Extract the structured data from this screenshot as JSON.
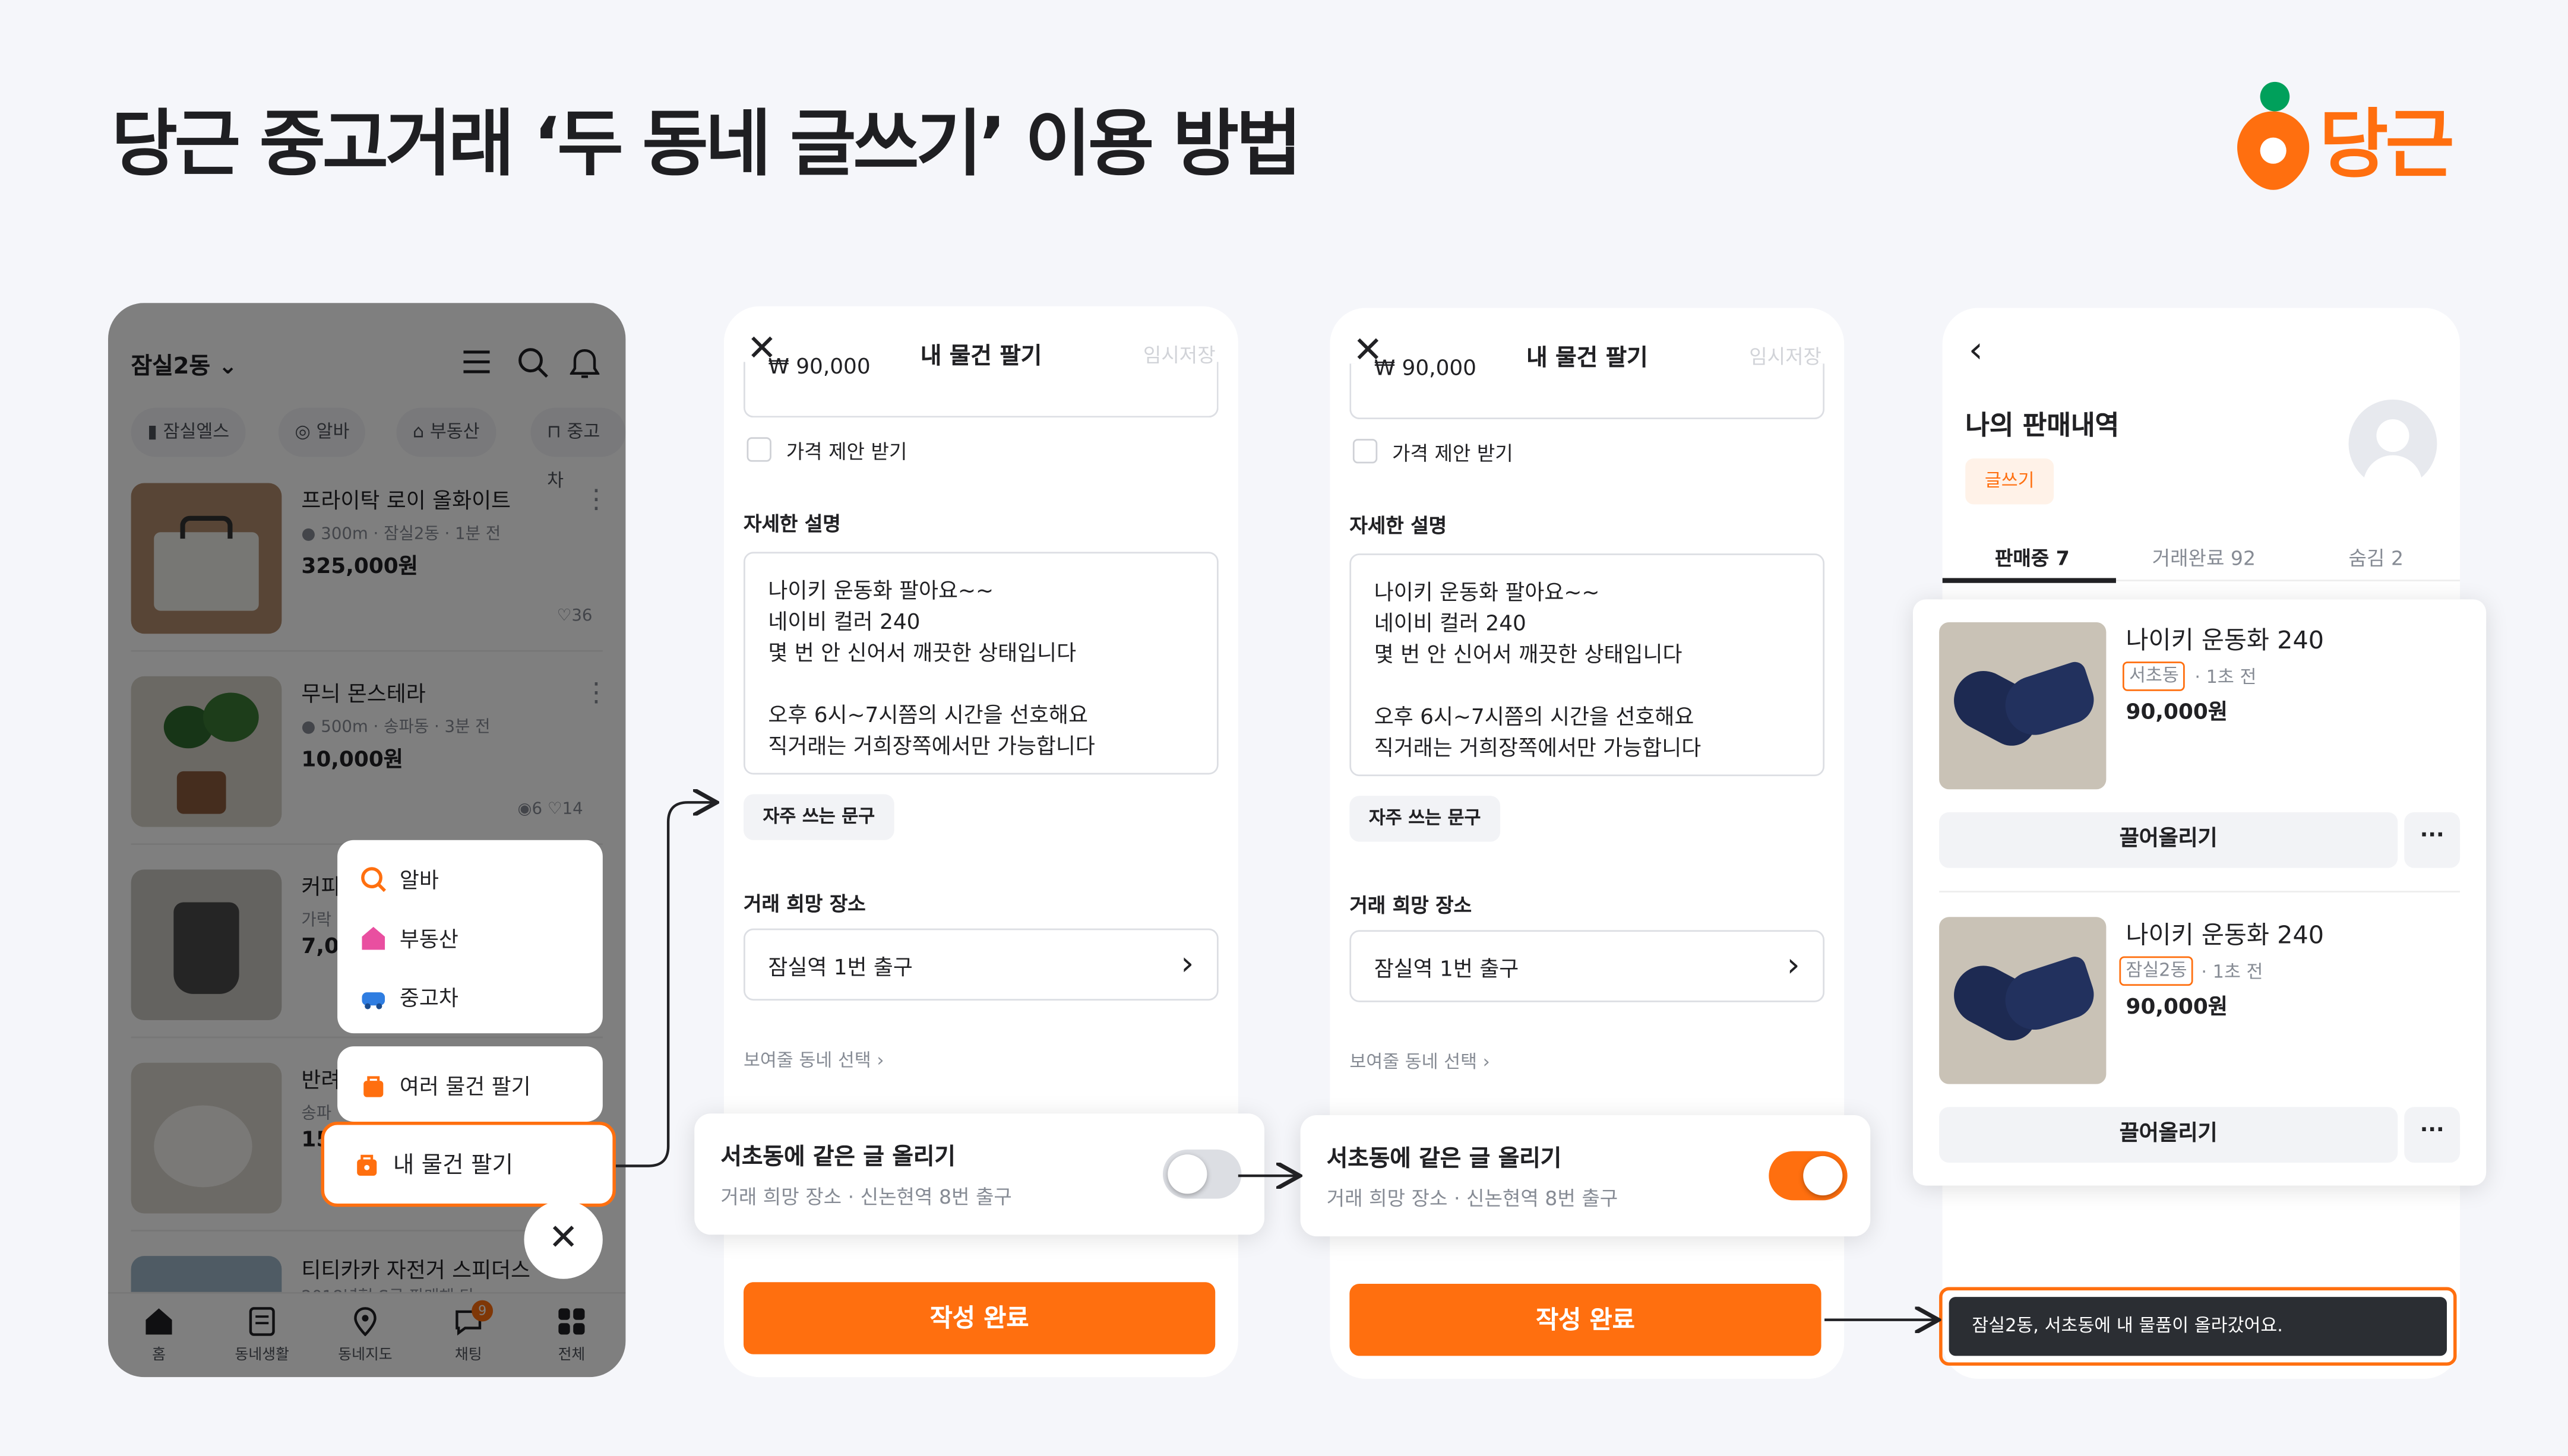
{
  "heading": "당근 중고거래 ‘두 동네 글쓰기’ 이용 방법",
  "logo_text": "당근",
  "colors": {
    "brand": "#ff6f0f",
    "toast": "#2b2e33"
  },
  "screen1": {
    "location": "잠실2동",
    "chips": [
      "잠실엘스",
      "알바",
      "부동산",
      "중고차"
    ],
    "items": [
      {
        "title": "프라이탁 로이 올화이트",
        "meta": "300m · 잠실2동 · 1분 전",
        "price": "325,000원",
        "likes": "36"
      },
      {
        "title": "무늬 몬스테라",
        "meta": "500m · 송파동 · 3분 전",
        "price": "10,000원",
        "chats": "6",
        "likes": "14"
      },
      {
        "title": "커피",
        "meta": "가락",
        "price": "7,0"
      },
      {
        "title": "반려",
        "meta": "송파",
        "price": "15"
      },
      {
        "title": "티티카카 자전거 스피더스 ",
        "meta": "2018년형 S급 판매해 다"
      }
    ],
    "menu_top": [
      "알바",
      "부동산",
      "중고차"
    ],
    "menu_bottom": [
      "여러 물건 팔기",
      "내 물건 팔기"
    ],
    "tabs": [
      "홈",
      "동네생활",
      "동네지도",
      "채팅",
      "전체"
    ],
    "chat_badge": "9"
  },
  "form": {
    "title": "내 물건 팔기",
    "draft": "임시저장",
    "price": "₩ 90,000",
    "price_offer": "가격 제안 받기",
    "desc_label": "자세한 설명",
    "desc_lines": [
      "나이키 운동화 팔아요~~",
      "네이비 컬러 240",
      "몇 번 안 신어서 깨끗한 상태입니다",
      "",
      "오후 6시~7시쯤의 시간을 선호해요",
      "직거래는 거희장쪽에서만 가능합니다"
    ],
    "phrases": "자주 쓰는 문구",
    "place_label": "거래 희망 장소",
    "place": "잠실역 1번 출구",
    "neighborhood": "보여줄 동네 선택",
    "sheet_title": "서초동에 같은 글 올리기",
    "sheet_sub": "거래 희망 장소 · 신논현역 8번 출구",
    "submit": "작성 완료"
  },
  "screen4": {
    "title": "나의 판매내역",
    "write": "글쓰기",
    "tabs": [
      "판매중 7",
      "거래완료 92",
      "숨김 2"
    ],
    "items": [
      {
        "title": "나이키 운동화 240",
        "dong": "서초동",
        "time": "1초 전",
        "price": "90,000원",
        "bump": "끌어올리기",
        "more": "···"
      },
      {
        "title": "나이키 운동화 240",
        "dong": "잠실2동",
        "time": "1초 전",
        "price": "90,000원",
        "bump": "끌어올리기",
        "more": "···"
      }
    ],
    "toast": "잠실2동, 서초동에 내 물품이 올라갔어요."
  }
}
